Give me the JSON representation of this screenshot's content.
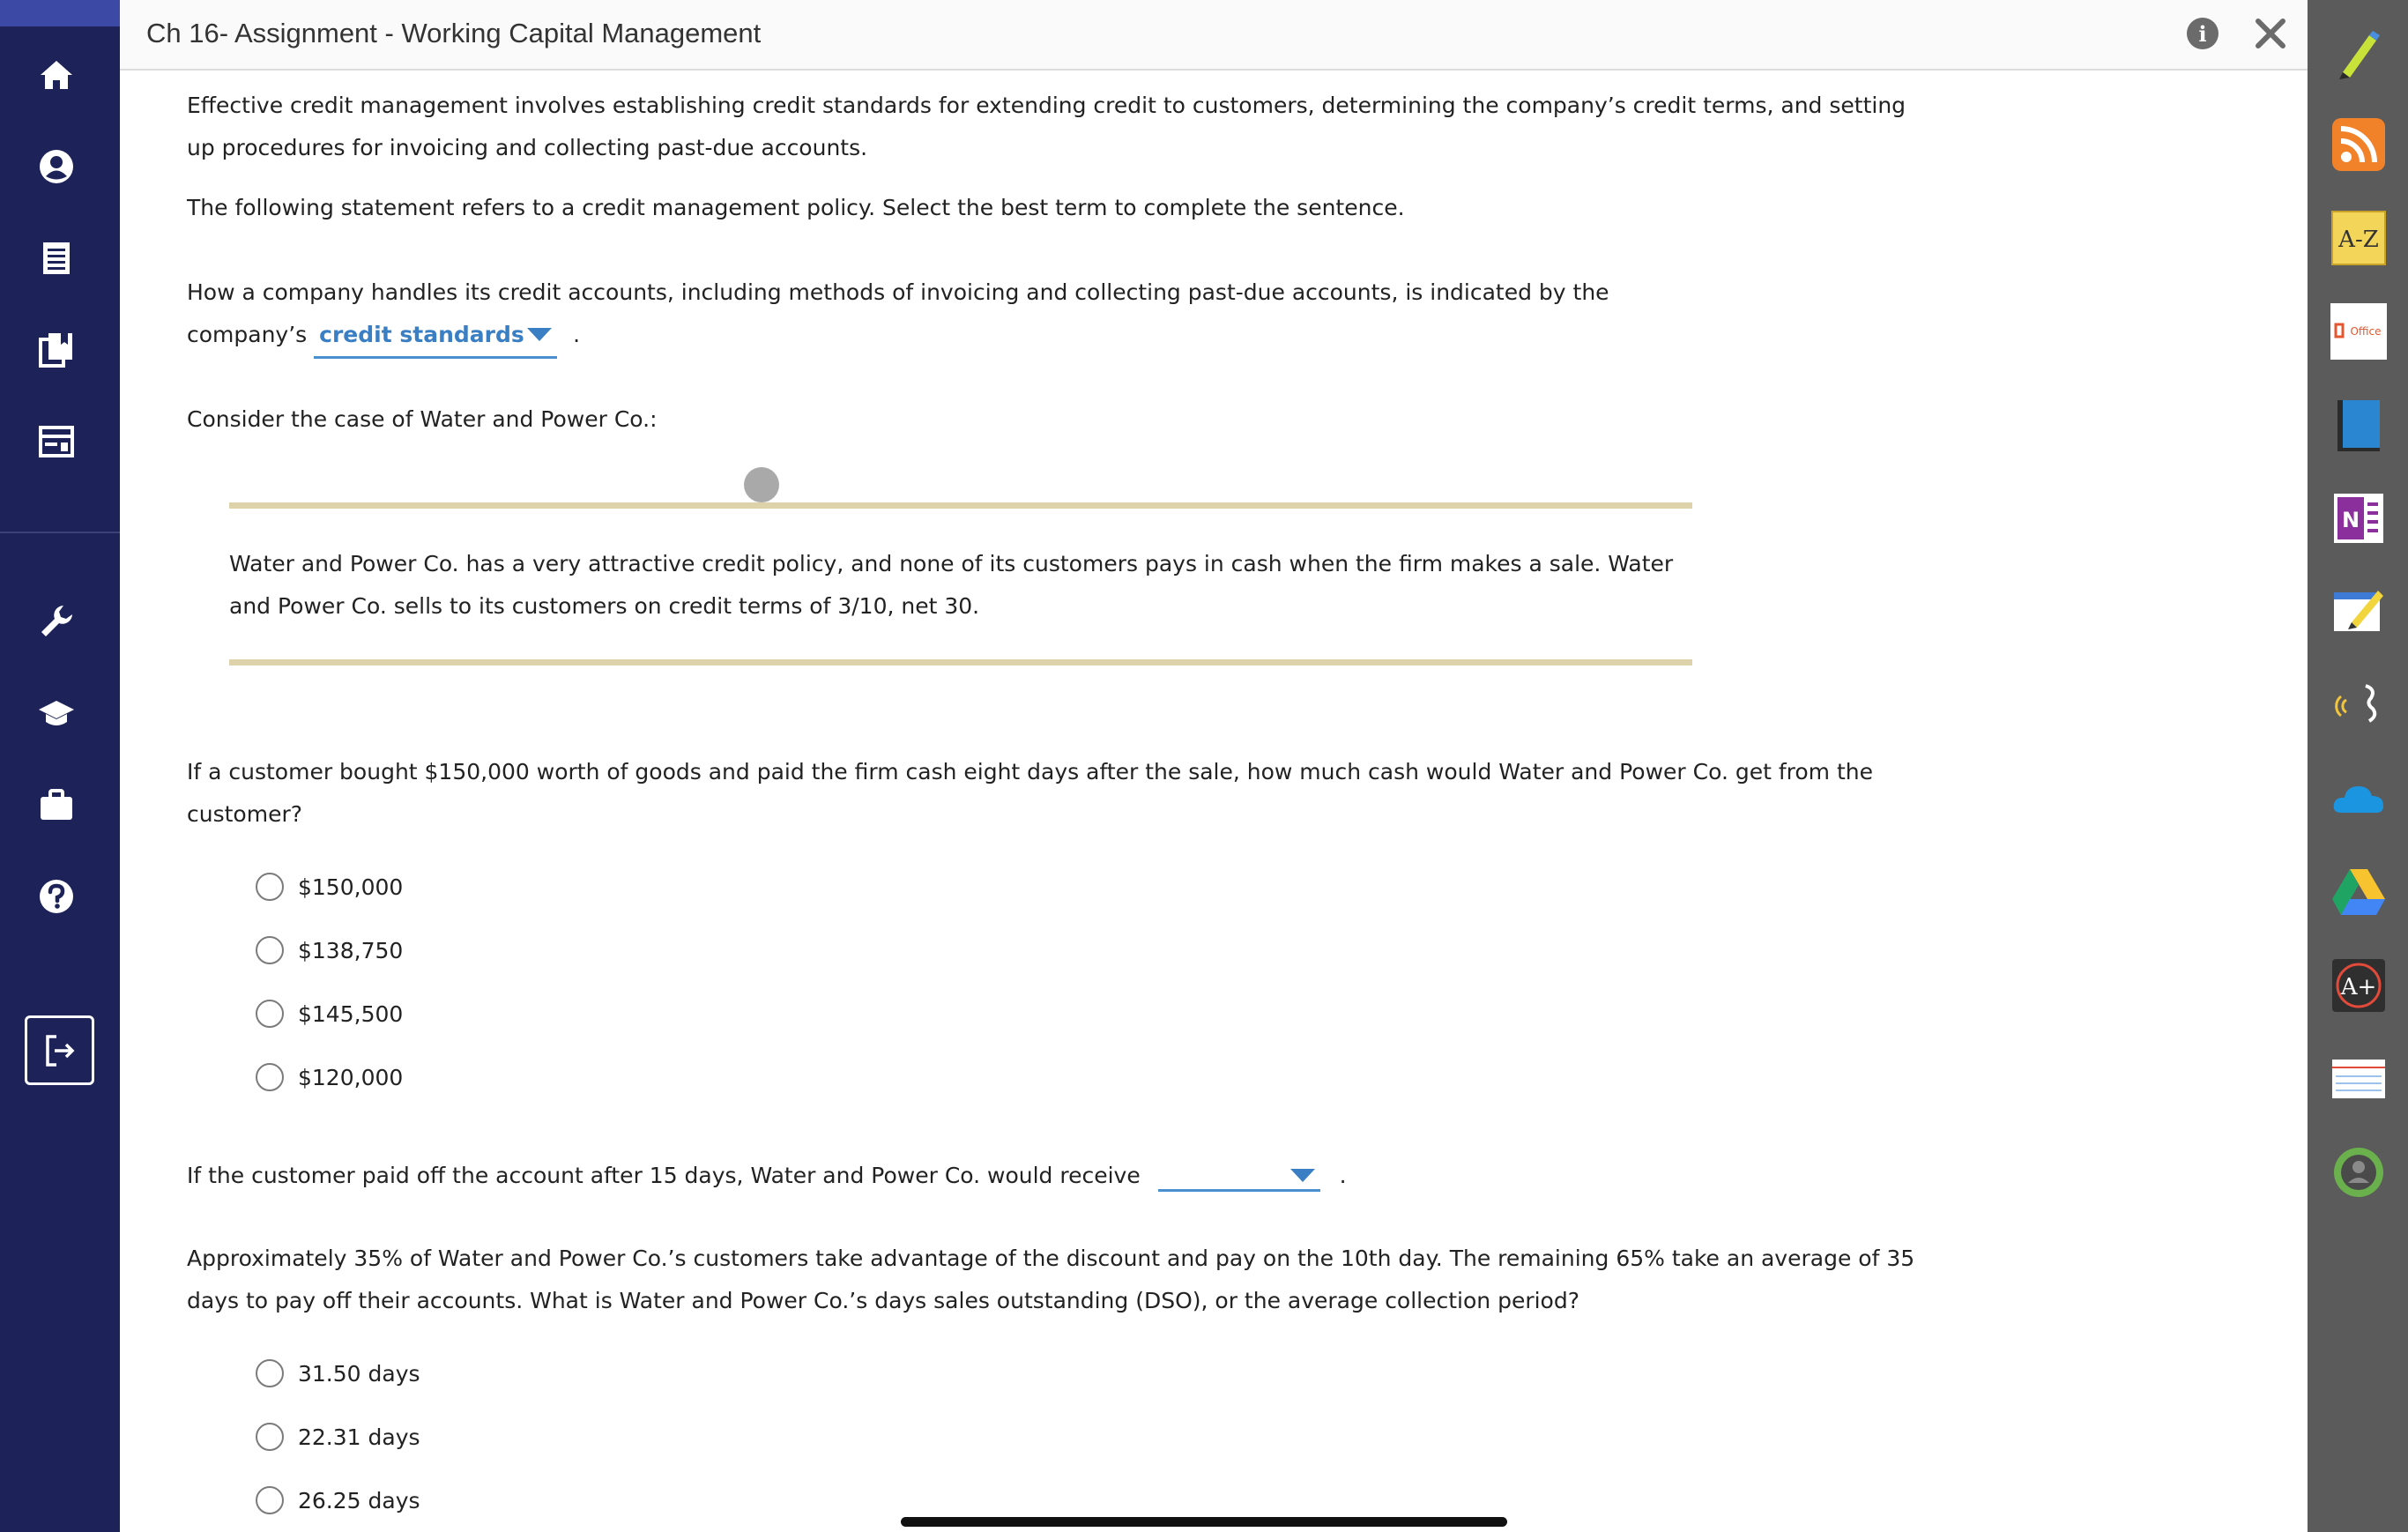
{
  "header": {
    "title": "Ch 16- Assignment - Working Capital Management",
    "info_label": "i"
  },
  "leftnav": {
    "items": [
      {
        "icon": "home-icon"
      },
      {
        "icon": "account-icon"
      },
      {
        "icon": "gradebook-icon"
      },
      {
        "icon": "library-icon"
      },
      {
        "icon": "browser-icon"
      },
      {
        "icon": "wrench-icon"
      },
      {
        "icon": "graduation-cap-icon"
      },
      {
        "icon": "briefcase-icon"
      },
      {
        "icon": "help-icon"
      },
      {
        "icon": "sign-out-icon"
      }
    ]
  },
  "rightbar": {
    "tools": [
      {
        "icon": "highlighter-icon"
      },
      {
        "icon": "rss-feed-icon"
      },
      {
        "icon": "glossary-az-icon",
        "label": "A-Z"
      },
      {
        "icon": "office-icon",
        "label": "Office"
      },
      {
        "icon": "ebook-icon"
      },
      {
        "icon": "onenote-icon",
        "label": "N"
      },
      {
        "icon": "notes-icon"
      },
      {
        "icon": "read-speaker-icon"
      },
      {
        "icon": "onedrive-icon"
      },
      {
        "icon": "google-drive-icon"
      },
      {
        "icon": "aplus-icon",
        "label": "A+"
      },
      {
        "icon": "flashcards-icon"
      },
      {
        "icon": "profile-ring-icon"
      }
    ]
  },
  "content": {
    "intro1": "Effective credit management involves establishing credit standards for extending credit to customers, determining the company’s credit terms, and setting up procedures for invoicing and collecting past-due accounts.",
    "intro2": "The following statement refers to a credit management policy. Select the best term to complete the sentence.",
    "statement_pre": "How a company handles its credit accounts, including methods of invoicing and collecting past-due accounts, is indicated by the company’s",
    "statement_selected": "credit standards",
    "statement_post": ".",
    "case_intro": "Consider the case of Water and Power Co.:",
    "scenario": "Water and Power Co. has a very attractive credit policy, and none of its customers pays in cash when the firm makes a sale. Water and Power Co. sells to its customers on credit terms of 3/10, net 30.",
    "q1": "If a customer bought $150,000 worth of goods and paid the firm cash eight days after the sale, how much cash would Water and Power Co. get from the customer?",
    "q1_options": [
      "$150,000",
      "$138,750",
      "$145,500",
      "$120,000"
    ],
    "q2_pre": "If the customer paid off the account after 15 days, Water and Power Co. would receive",
    "q2_selected": "",
    "q2_post": ".",
    "q3": "Approximately 35% of Water and Power Co.’s customers take advantage of the discount and pay on the 10th day. The remaining 65% take an average of 35 days to pay off their accounts. What is Water and Power Co.’s days sales outstanding (DSO), or the average collection period?",
    "q3_options": [
      "31.50 days",
      "22.31 days",
      "26.25 days"
    ]
  },
  "colors": {
    "nav_bg": "#1d2358",
    "rightbar_bg": "#5b5b5b",
    "dropdown_accent": "#3a7fc4",
    "scenario_rule": "#ddd2aa"
  }
}
